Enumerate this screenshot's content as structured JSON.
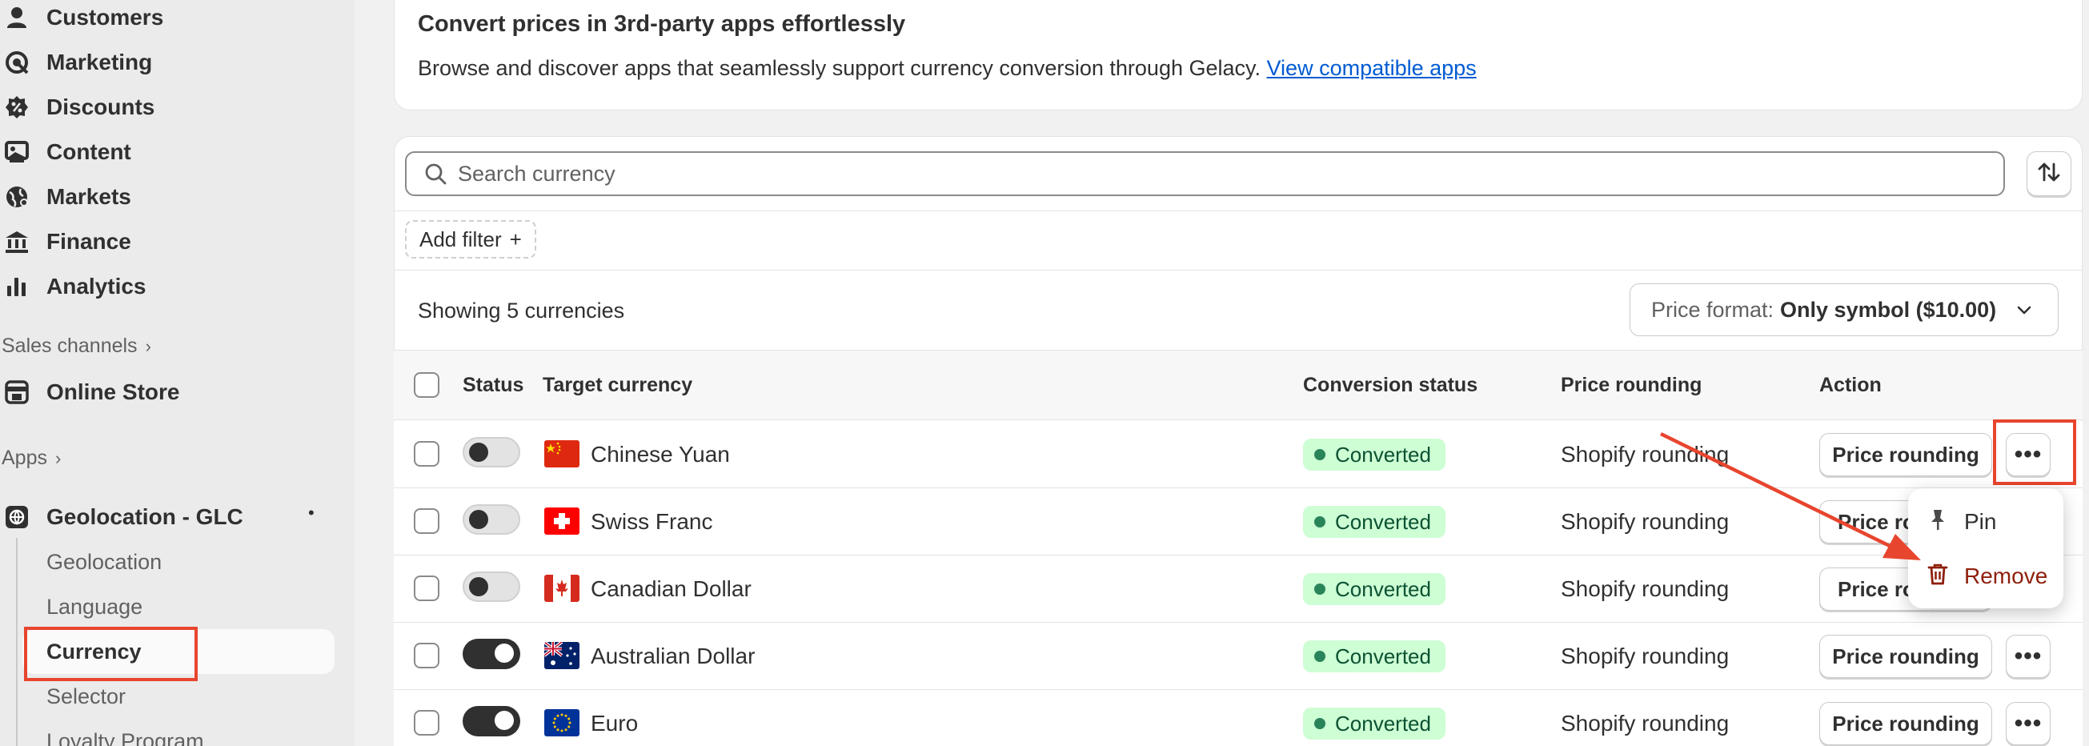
{
  "sidebar": {
    "items": [
      {
        "label": "Customers",
        "icon": "person-icon"
      },
      {
        "label": "Marketing",
        "icon": "target-icon"
      },
      {
        "label": "Discounts",
        "icon": "discount-icon"
      },
      {
        "label": "Content",
        "icon": "content-icon"
      },
      {
        "label": "Markets",
        "icon": "globe-icon"
      },
      {
        "label": "Finance",
        "icon": "bank-icon"
      },
      {
        "label": "Analytics",
        "icon": "bar-chart-icon"
      }
    ],
    "sales_channels_label": "Sales channels",
    "online_store_label": "Online Store",
    "apps_label": "Apps",
    "app_name": "Geolocation - GLC",
    "app_dot": "•",
    "app_subitems": [
      "Geolocation",
      "Language",
      "Currency",
      "Selector",
      "Loyalty Program"
    ]
  },
  "top_card": {
    "title": "Convert prices in 3rd-party apps effortlessly",
    "description": "Browse and discover apps that seamlessly support currency conversion through Gelacy.",
    "link_text": "View compatible apps"
  },
  "search": {
    "placeholder": "Search currency"
  },
  "filter": {
    "add_filter_label": "Add filter",
    "plus": "+"
  },
  "summary": {
    "showing": "Showing 5 currencies"
  },
  "price_format": {
    "label": "Price format:",
    "value": "Only symbol ($10.00)"
  },
  "table": {
    "headers": {
      "status": "Status",
      "target_currency": "Target currency",
      "conversion_status": "Conversion status",
      "price_rounding": "Price rounding",
      "action": "Action"
    },
    "rows": [
      {
        "name": "Chinese Yuan",
        "enabled": false,
        "conversion": "Converted",
        "rounding": "Shopify rounding",
        "button": "Price rounding",
        "flag": "china"
      },
      {
        "name": "Swiss Franc",
        "enabled": false,
        "conversion": "Converted",
        "rounding": "Shopify rounding",
        "button": "Price ro",
        "flag": "switzerland"
      },
      {
        "name": "Canadian Dollar",
        "enabled": false,
        "conversion": "Converted",
        "rounding": "Shopify rounding",
        "button": "Price ro",
        "flag": "canada"
      },
      {
        "name": "Australian Dollar",
        "enabled": true,
        "conversion": "Converted",
        "rounding": "Shopify rounding",
        "button": "Price rounding",
        "flag": "australia"
      },
      {
        "name": "Euro",
        "enabled": true,
        "conversion": "Converted",
        "rounding": "Shopify rounding",
        "button": "Price rounding",
        "flag": "eu"
      }
    ],
    "more_label": "•••"
  },
  "popover": {
    "pin_label": "Pin",
    "remove_label": "Remove"
  },
  "colors": {
    "annotation_red": "#e8452e",
    "converted_bg": "#cdfed4",
    "remove_text": "#8e1f0b"
  }
}
